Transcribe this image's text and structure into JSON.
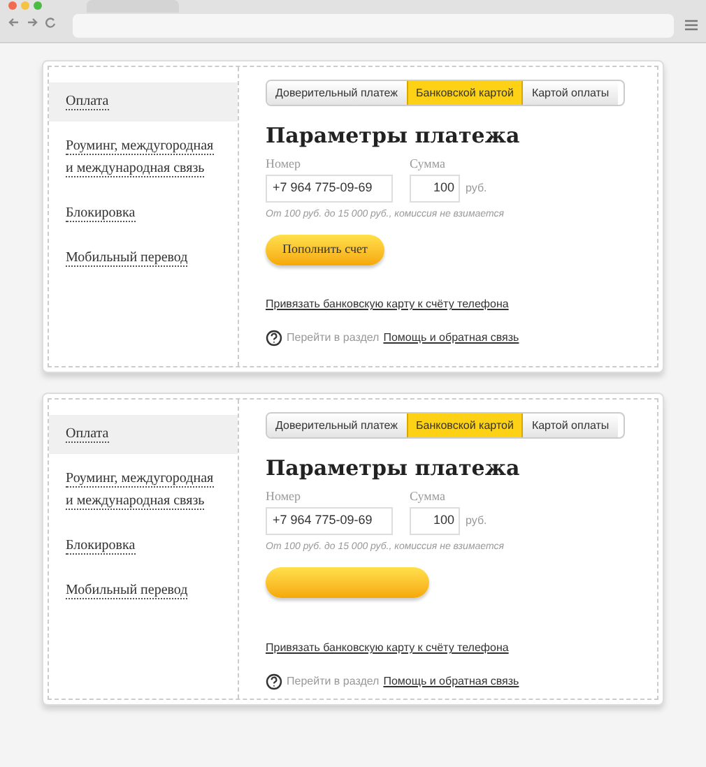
{
  "panels": [
    {
      "sidebar": [
        {
          "label": "Оплата",
          "selected": true
        },
        {
          "label": "Роуминг, междугородная и международная связь",
          "selected": false
        },
        {
          "label": "Блокировка",
          "selected": false
        },
        {
          "label": "Мобильный перевод",
          "selected": false
        }
      ],
      "tabs": [
        {
          "label": "Доверительный платеж",
          "selected": false
        },
        {
          "label": "Банковской картой",
          "selected": true
        },
        {
          "label": "Картой оплаты",
          "selected": false
        }
      ],
      "title": "Параметры платежа",
      "number": {
        "label": "Номер",
        "value": "+7 964 775-09-69"
      },
      "amount": {
        "label": "Сумма",
        "value": "100",
        "unit": "руб."
      },
      "hint": "От 100 руб. до 15 000 руб., комиссия не взимается",
      "button": {
        "label": "Пополнить счет"
      },
      "link": "Привязать банковскую карту к счёту телефона",
      "help": {
        "prefix": "Перейти в раздел",
        "link": "Помощь и обратная связь"
      }
    },
    {
      "sidebar": [
        {
          "label": "Оплата",
          "selected": true
        },
        {
          "label": "Роуминг, междугородная и международная связь",
          "selected": false
        },
        {
          "label": "Блокировка",
          "selected": false
        },
        {
          "label": "Мобильный перевод",
          "selected": false
        }
      ],
      "tabs": [
        {
          "label": "Доверительный платеж",
          "selected": false
        },
        {
          "label": "Банковской картой",
          "selected": true
        },
        {
          "label": "Картой оплаты",
          "selected": false
        }
      ],
      "title": "Параметры платежа",
      "number": {
        "label": "Номер",
        "value": "+7 964 775-09-69"
      },
      "amount": {
        "label": "Сумма",
        "value": "100",
        "unit": "руб."
      },
      "hint": "От 100 руб. до 15 000 руб., комиссия не взимается",
      "link": "Привязать банковскую карту к счёту телефона",
      "help": {
        "prefix": "Перейти в раздел",
        "link": "Помощь и обратная связь"
      }
    }
  ]
}
